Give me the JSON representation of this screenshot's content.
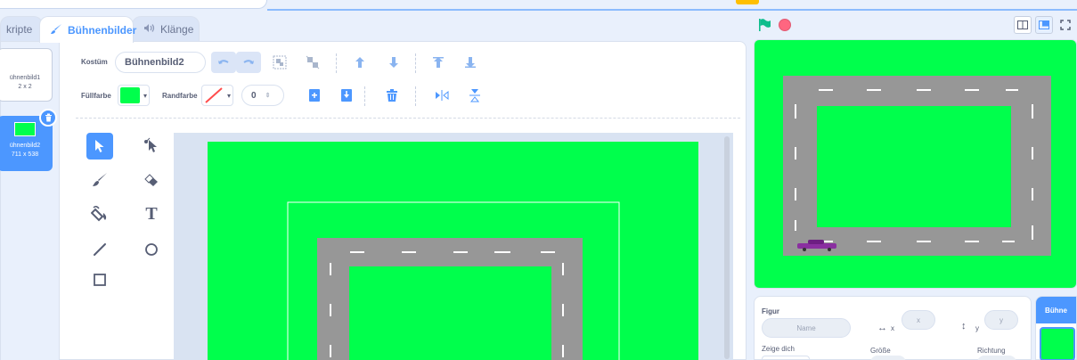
{
  "tabs": [
    {
      "label": "kripte",
      "icon": "code-icon"
    },
    {
      "label": "Bühnenbilder",
      "icon": "brush-icon"
    },
    {
      "label": "Klänge",
      "icon": "speaker-icon"
    }
  ],
  "costumes": [
    {
      "name": "ühnenbild1",
      "size": "2 x 2"
    },
    {
      "name": "ühnenbild2",
      "size": "711 x 538"
    }
  ],
  "toolbar": {
    "costume_label": "Kostüm",
    "costume_name": "Bühnenbild2",
    "fill_label": "Füllfarbe",
    "outline_label": "Randfarbe",
    "outline_width": "0"
  },
  "colors": {
    "fill": "#00ff4c",
    "road": "#979797",
    "accent": "#4c97ff",
    "stop": "#ff6680",
    "flag": "#0fbd8c"
  },
  "tools": [
    "select-tool",
    "reshape-tool",
    "brush-tool",
    "eraser-tool",
    "fill-tool",
    "text-tool",
    "line-tool",
    "circle-tool",
    "rectangle-tool"
  ],
  "text_tool_glyph": "T",
  "sprite_info": {
    "figur_label": "Figur",
    "name_placeholder": "Name",
    "x_label": "x",
    "x_placeholder": "x",
    "y_label": "y",
    "y_placeholder": "y",
    "show_label": "Zeige dich",
    "size_label": "Größe",
    "direction_label": "Richtung"
  },
  "stage_panel": {
    "label": "Bühne"
  }
}
